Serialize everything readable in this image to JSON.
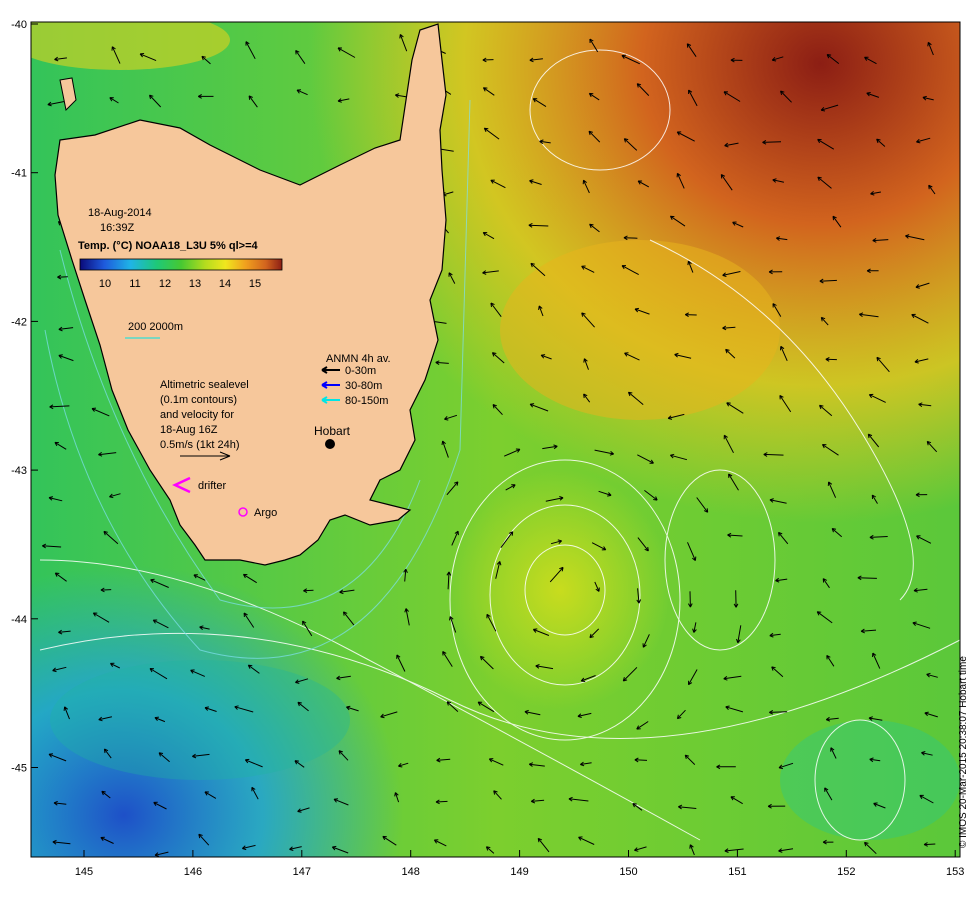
{
  "map": {
    "date": "18-Aug-2014",
    "time": "16:39Z",
    "colorbar_title": "Temp. (°C) NOAA18_L3U 5% ql>=4",
    "colorbar_ticks": [
      "10",
      "11",
      "12",
      "13",
      "14",
      "15"
    ],
    "colorbar_colors": [
      "#0a0a7a",
      "#1e5adc",
      "#1fb4e6",
      "#1ec878",
      "#46c832",
      "#b4dc1e",
      "#f0e61e",
      "#f0a01e",
      "#d2641e",
      "#8c1e14"
    ],
    "isobath_label": "200  2000m",
    "anmn_title": "ANMN 4h av.",
    "anmn_depths": [
      "0-30m",
      "30-80m",
      "80-150m"
    ],
    "anmn_colors": [
      "#000000",
      "#0000ff",
      "#00e5e5"
    ],
    "altimetry_note": [
      "Altimetric sealevel",
      "(0.1m contours)",
      "and velocity for",
      "18-Aug 16Z",
      "0.5m/s (1kt 24h)"
    ],
    "place_label": "Hobart",
    "drifter_label": "drifter",
    "argo_label": "Argo",
    "lon_ticks": [
      "145",
      "146",
      "147",
      "148",
      "149",
      "150",
      "151",
      "152",
      "153"
    ],
    "lat_ticks": [
      "-40",
      "-41",
      "-42",
      "-43",
      "-44",
      "-45"
    ],
    "credit": "© IMOS 20-Mar-2015 20:38:07 Hobart time",
    "land_color": "#f6c79b"
  }
}
